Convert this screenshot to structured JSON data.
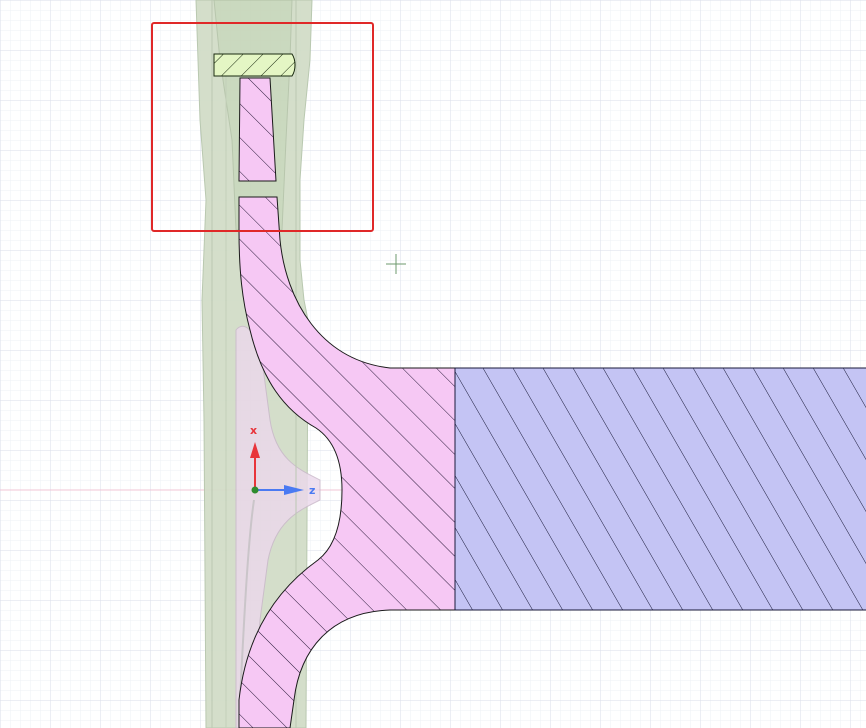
{
  "viewport": {
    "axes": {
      "x_label": "x",
      "z_label": "z",
      "x_color": "#e8343a",
      "z_color": "#4a7af2",
      "origin_color": "#2e8b2e"
    },
    "colors": {
      "background": "#ffffff",
      "grid_minor": "#eef0f6",
      "grid_major": "#d6dae8",
      "horizontal_axis_line": "#f2c4d6",
      "ghost_body_fill": "#c8d8c0",
      "ghost_body_stroke": "#b0c4a8",
      "section_pink_fill": "#f6c8f4",
      "section_pink_hatch": "#2a1a3a",
      "section_blue_fill": "#c4c4f4",
      "section_blue_hatch": "#1a1a3a",
      "green_profile_fill": "#e4f6c4",
      "selection_box": "#e02828",
      "cursor": "#6e9a6e"
    },
    "icons": {
      "cursor": "crosshair-cursor-icon",
      "selection": "selection-rectangle"
    }
  }
}
